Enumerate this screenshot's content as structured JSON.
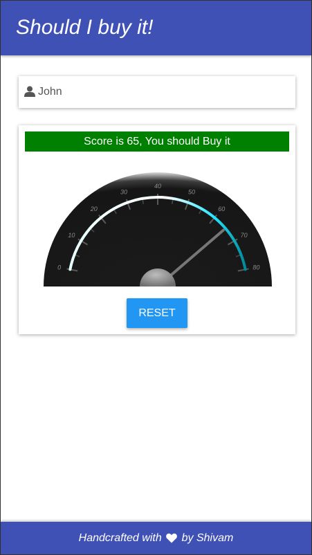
{
  "header": {
    "title": "Should I buy it!"
  },
  "name_field": {
    "value": "John",
    "icon": "user-icon"
  },
  "result": {
    "banner_text": "Score is 65, You should Buy it",
    "banner_color": "#008000"
  },
  "gauge": {
    "value": 65,
    "min": 0,
    "max": 80,
    "tick_labels": [
      "0",
      "10",
      "20",
      "30",
      "40",
      "50",
      "60",
      "70",
      "80"
    ]
  },
  "reset_button": {
    "label": "RESET",
    "color": "#2196f3"
  },
  "footer": {
    "text_before": "Handcrafted with",
    "icon": "heart-icon",
    "text_after": "by Shivam"
  },
  "colors": {
    "primary": "#3f51b5",
    "accent": "#2196f3"
  }
}
